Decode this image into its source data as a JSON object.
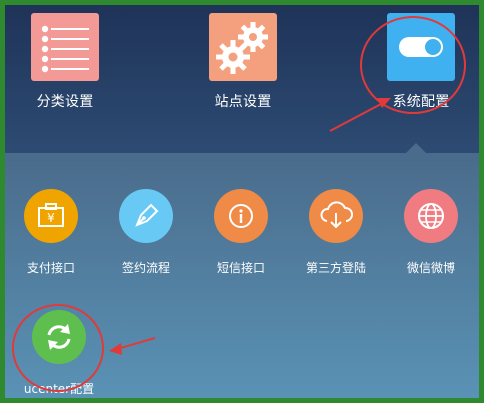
{
  "top_tiles": [
    {
      "label": "分类设置",
      "icon": "list-icon"
    },
    {
      "label": "站点设置",
      "icon": "gears-icon"
    },
    {
      "label": "系统配置",
      "icon": "toggle-icon"
    }
  ],
  "panel_items": [
    {
      "label": "支付接口",
      "icon": "wallet-icon",
      "color": "#f0a400"
    },
    {
      "label": "签约流程",
      "icon": "pen-icon",
      "color": "#67c9f4"
    },
    {
      "label": "短信接口",
      "icon": "info-icon",
      "color": "#ef8a47"
    },
    {
      "label": "第三方登陆",
      "icon": "cloud-download-icon",
      "color": "#ef8a47"
    },
    {
      "label": "微信微博",
      "icon": "globe-icon",
      "color": "#f07c82"
    },
    {
      "label": "ucenter配置",
      "icon": "refresh-icon",
      "color": "#5fbf4e"
    }
  ],
  "annotation_color": "#e03a3a"
}
